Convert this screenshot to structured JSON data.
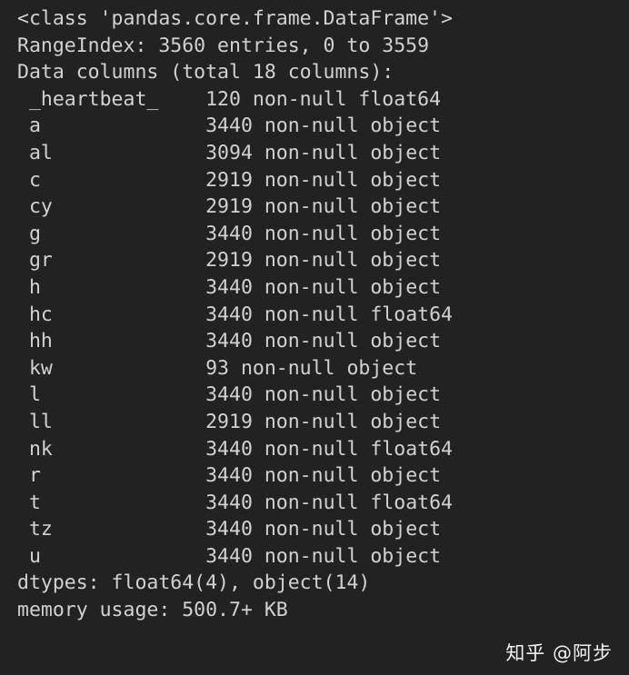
{
  "terminal": {
    "background_color": "#222222",
    "text_color": "#d2d2d2",
    "header": {
      "class_line": "<class 'pandas.core.frame.DataFrame'>",
      "index_line": "RangeIndex: 3560 entries, 0 to 3559",
      "columns_line": "Data columns (total 18 columns):"
    },
    "columns": [
      {
        "name": "_heartbeat_",
        "count": "120",
        "nonnull": "non-null",
        "dtype": "float64"
      },
      {
        "name": "a",
        "count": "3440",
        "nonnull": "non-null",
        "dtype": "object"
      },
      {
        "name": "al",
        "count": "3094",
        "nonnull": "non-null",
        "dtype": "object"
      },
      {
        "name": "c",
        "count": "2919",
        "nonnull": "non-null",
        "dtype": "object"
      },
      {
        "name": "cy",
        "count": "2919",
        "nonnull": "non-null",
        "dtype": "object"
      },
      {
        "name": "g",
        "count": "3440",
        "nonnull": "non-null",
        "dtype": "object"
      },
      {
        "name": "gr",
        "count": "2919",
        "nonnull": "non-null",
        "dtype": "object"
      },
      {
        "name": "h",
        "count": "3440",
        "nonnull": "non-null",
        "dtype": "object"
      },
      {
        "name": "hc",
        "count": "3440",
        "nonnull": "non-null",
        "dtype": "float64"
      },
      {
        "name": "hh",
        "count": "3440",
        "nonnull": "non-null",
        "dtype": "object"
      },
      {
        "name": "kw",
        "count": "93",
        "nonnull": "non-null",
        "dtype": "object"
      },
      {
        "name": "l",
        "count": "3440",
        "nonnull": "non-null",
        "dtype": "object"
      },
      {
        "name": "ll",
        "count": "2919",
        "nonnull": "non-null",
        "dtype": "object"
      },
      {
        "name": "nk",
        "count": "3440",
        "nonnull": "non-null",
        "dtype": "float64"
      },
      {
        "name": "r",
        "count": "3440",
        "nonnull": "non-null",
        "dtype": "object"
      },
      {
        "name": "t",
        "count": "3440",
        "nonnull": "non-null",
        "dtype": "float64"
      },
      {
        "name": "tz",
        "count": "3440",
        "nonnull": "non-null",
        "dtype": "object"
      },
      {
        "name": "u",
        "count": "3440",
        "nonnull": "non-null",
        "dtype": "object"
      }
    ],
    "footer": {
      "dtypes_line": "dtypes: float64(4), object(14)",
      "memory_line": "memory usage: 500.7+ KB"
    }
  },
  "watermark": {
    "text": "知乎 @阿步"
  }
}
